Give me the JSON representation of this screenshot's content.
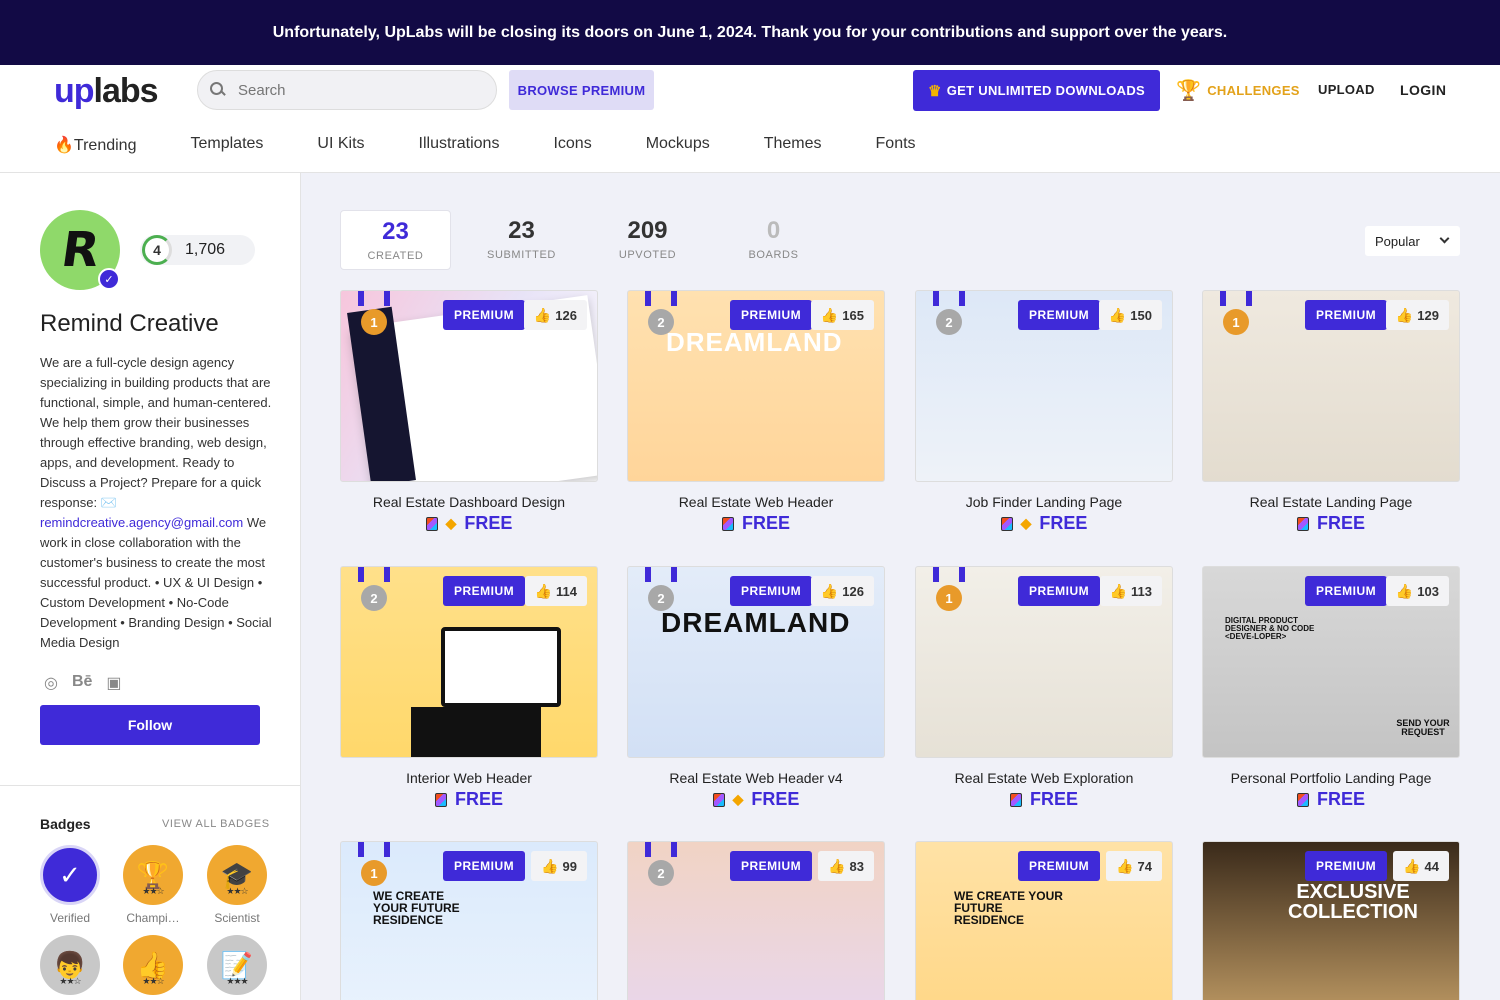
{
  "banner": "Unfortunately, UpLabs will be closing its doors on June 1, 2024. Thank you for your contributions and support over the years.",
  "header": {
    "logo_up": "up",
    "logo_labs": "labs",
    "search_placeholder": "Search",
    "browse_premium": "BROWSE PREMIUM",
    "get_unlimited": "GET UNLIMITED DOWNLOADS",
    "challenges": "CHALLENGES",
    "upload": "UPLOAD",
    "login": "LOGIN"
  },
  "categories": [
    "🔥Trending",
    "Templates",
    "UI Kits",
    "Illustrations",
    "Icons",
    "Mockups",
    "Themes",
    "Fonts"
  ],
  "profile": {
    "level": "4",
    "points": "1,706",
    "name": "Remind Creative",
    "bio_part1": "We are a full-cycle design agency specializing in building products that are functional, simple, and human-centered. We help them grow their businesses through effective branding, web design, apps, and development. Ready to Discuss a Project? Prepare for a quick response: ✉️",
    "email": "remindcreative.agency@gmail.com",
    "bio_part2": " We work in close collaboration with the customer's business to create the most successful product. • UX & UI Design • Custom Development • No-Code Development • Branding Design • Social Media Design",
    "follow": "Follow"
  },
  "badges": {
    "title": "Badges",
    "view_all": "VIEW ALL BADGES",
    "items": [
      {
        "label": "Verified",
        "icon": "checkmark-icon",
        "color": "#3f2ad8"
      },
      {
        "label": "Champi…",
        "icon": "trophy-icon",
        "color": "#f0a830"
      },
      {
        "label": "Scientist",
        "icon": "graduation-cap-icon",
        "color": "#f0a830"
      },
      {
        "label": "",
        "icon": "person-icon",
        "color": "#c8c8c8"
      },
      {
        "label": "",
        "icon": "thumbs-up-icon",
        "color": "#f0a830"
      },
      {
        "label": "",
        "icon": "notepad-icon",
        "color": "#c8c8c8"
      }
    ]
  },
  "stats": [
    {
      "value": "23",
      "label": "CREATED"
    },
    {
      "value": "23",
      "label": "SUBMITTED"
    },
    {
      "value": "209",
      "label": "UPVOTED"
    },
    {
      "value": "0",
      "label": "BOARDS"
    }
  ],
  "sort": "Popular",
  "premium_label": "PREMIUM",
  "free_label": "FREE",
  "cards": [
    {
      "title": "Real Estate Dashboard Design",
      "likes": "126",
      "medal": "1",
      "gem": true
    },
    {
      "title": "Real Estate Web Header",
      "likes": "165",
      "medal": "2",
      "gem": false
    },
    {
      "title": "Job Finder Landing Page",
      "likes": "150",
      "medal": "2",
      "gem": true
    },
    {
      "title": "Real Estate Landing Page",
      "likes": "129",
      "medal": "1",
      "gem": false
    },
    {
      "title": "Interior Web Header",
      "likes": "114",
      "medal": "2",
      "gem": false
    },
    {
      "title": "Real Estate Web Header v4",
      "likes": "126",
      "medal": "2",
      "gem": true
    },
    {
      "title": "Real Estate Web Exploration",
      "likes": "113",
      "medal": "1",
      "gem": false
    },
    {
      "title": "Personal Portfolio Landing Page",
      "likes": "103",
      "medal": "",
      "gem": false
    },
    {
      "title": "",
      "likes": "99",
      "medal": "1",
      "gem": false
    },
    {
      "title": "",
      "likes": "83",
      "medal": "2",
      "gem": false
    },
    {
      "title": "",
      "likes": "74",
      "medal": "",
      "gem": false
    },
    {
      "title": "",
      "likes": "44",
      "medal": "",
      "gem": false
    }
  ],
  "thumb_text": {
    "dreamland": "DREAMLAND",
    "we_create": "WE CREATE YOUR FUTURE RESIDENCE",
    "exclusive": "EXCLUSIVE COLLECTION",
    "digital": "DIGITAL PRODUCT DESIGNER & NO CODE <DEVE-LOPER>",
    "send": "SEND YOUR REQUEST"
  }
}
